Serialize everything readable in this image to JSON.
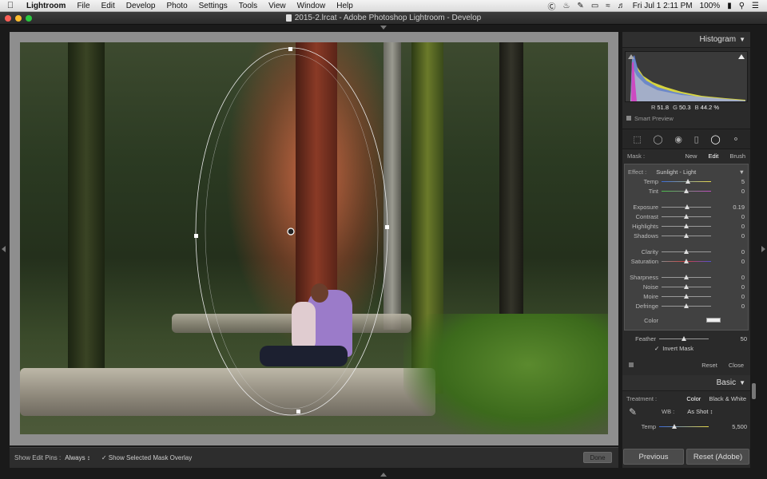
{
  "menubar": {
    "app": "Lightroom",
    "items": [
      "File",
      "Edit",
      "Develop",
      "Photo",
      "Settings",
      "Tools",
      "View",
      "Window",
      "Help"
    ],
    "battery": "100%",
    "clock": "Fri Jul 1  2:11 PM"
  },
  "window": {
    "title": "2015-2.lrcat - Adobe Photoshop Lightroom - Develop"
  },
  "histogram": {
    "header": "Histogram",
    "r_label": "R",
    "r_value": "51.8",
    "g_label": "G",
    "g_value": "50.3",
    "b_label": "B",
    "b_value": "44.2 %",
    "smart_preview": "Smart Preview"
  },
  "mask": {
    "label": "Mask :",
    "new": "New",
    "edit": "Edit",
    "brush": "Brush",
    "effect_label": "Effect :",
    "effect_value": "Sunlight - Light",
    "sliders": [
      {
        "name": "Temp",
        "value": "5",
        "pos": 0.53
      },
      {
        "name": "Tint",
        "value": "0",
        "pos": 0.5
      },
      {
        "name": "Exposure",
        "value": "0.19",
        "pos": 0.52
      },
      {
        "name": "Contrast",
        "value": "0",
        "pos": 0.5
      },
      {
        "name": "Highlights",
        "value": "0",
        "pos": 0.5
      },
      {
        "name": "Shadows",
        "value": "0",
        "pos": 0.5
      },
      {
        "name": "Clarity",
        "value": "0",
        "pos": 0.5
      },
      {
        "name": "Saturation",
        "value": "0",
        "pos": 0.5
      },
      {
        "name": "Sharpness",
        "value": "0",
        "pos": 0.5
      },
      {
        "name": "Noise",
        "value": "0",
        "pos": 0.5
      },
      {
        "name": "Moire",
        "value": "0",
        "pos": 0.5
      },
      {
        "name": "Defringe",
        "value": "0",
        "pos": 0.5
      }
    ],
    "color_label": "Color",
    "feather_label": "Feather",
    "feather_value": "50",
    "feather_pos": 0.5,
    "invert_mask": "Invert Mask",
    "reset": "Reset",
    "close": "Close"
  },
  "basic": {
    "header": "Basic",
    "treatment_label": "Treatment :",
    "color": "Color",
    "bw": "Black & White",
    "wb_label": "WB :",
    "wb_value": "As Shot ↕",
    "temp_label": "Temp",
    "temp_value": "5,500",
    "temp_pos": 0.3
  },
  "toolbar": {
    "show_edit_pins": "Show Edit Pins :",
    "pins_value": "Always ↕",
    "show_overlay": "Show Selected Mask Overlay",
    "done": "Done"
  },
  "buttons": {
    "previous": "Previous",
    "reset_adobe": "Reset (Adobe)"
  }
}
